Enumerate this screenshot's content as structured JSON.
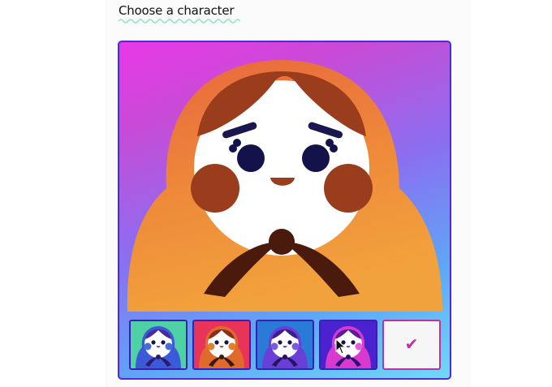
{
  "header": {
    "title": "Choose a character"
  },
  "characters": [
    {
      "icon": "character-green-icon",
      "background": "#4fd1a6",
      "hood": "#3c5ad8",
      "hair": "#4a2a9e",
      "cheek": "#4a6bd8",
      "scarf": "#2a1b6b"
    },
    {
      "icon": "character-red-icon",
      "background": "#e8345a",
      "hood": "#e06a2c",
      "hair": "#8a2f1a",
      "cheek": "#e0802c",
      "scarf": "#3a1a10"
    },
    {
      "icon": "character-blue-icon",
      "background": "#2a7bd8",
      "hood": "#6a3fd8",
      "hair": "#3a1f8e",
      "cheek": "#7a5ae0",
      "scarf": "#24165e"
    },
    {
      "icon": "character-purple-icon",
      "background": "#4a22d0",
      "hood": "#d83ad0",
      "hair": "#5a1a9e",
      "cheek": "#e060d8",
      "scarf": "#2a0f6e"
    }
  ],
  "selected_tile": {
    "check": "✔"
  },
  "colors": {
    "accent": "#4c2bd6",
    "selected_border": "#c0309f"
  }
}
